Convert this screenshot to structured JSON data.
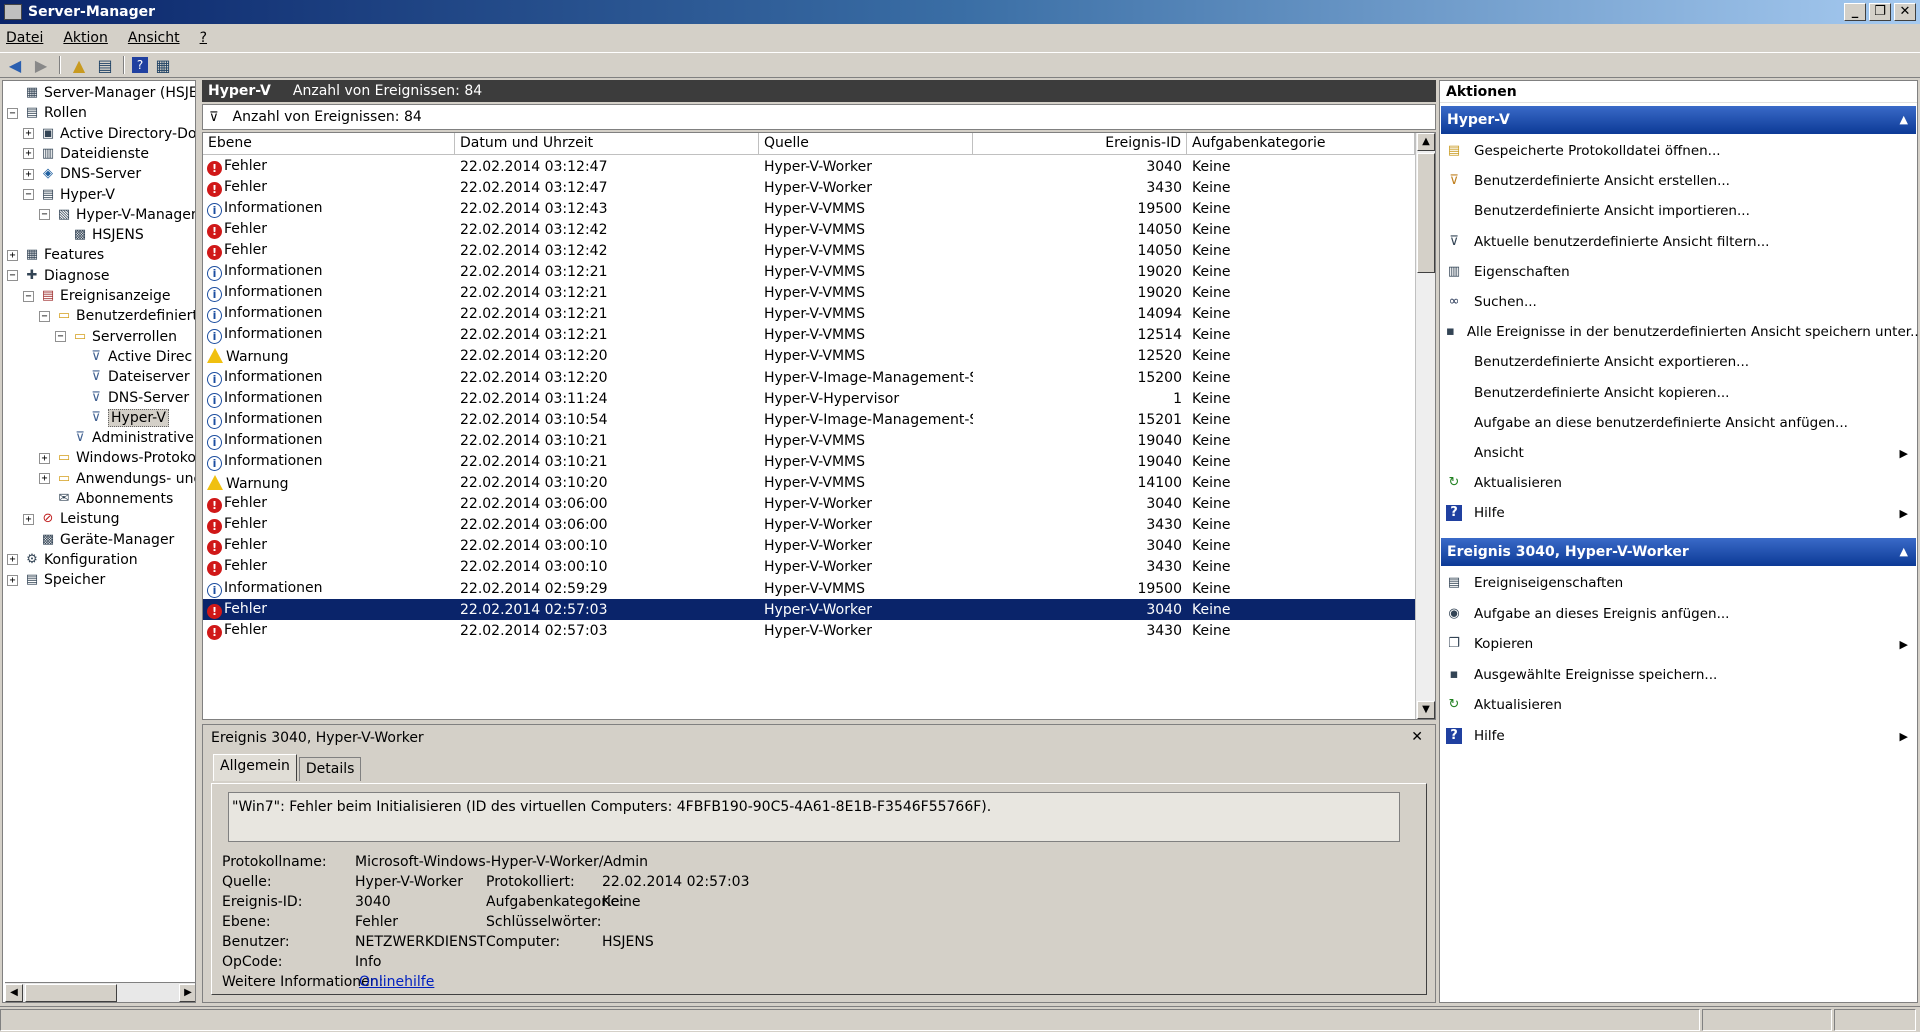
{
  "window": {
    "title": "Server-Manager"
  },
  "menu": [
    "Datei",
    "Aktion",
    "Ansicht",
    "?"
  ],
  "tree": [
    {
      "label": "Server-Manager (HSJENS)",
      "level": 0,
      "exp": "",
      "icon": "server-icon"
    },
    {
      "label": "Rollen",
      "level": 0,
      "exp": "−",
      "icon": "roles-icon"
    },
    {
      "label": "Active Directory-Dom",
      "level": 1,
      "exp": "+",
      "icon": "ad-icon"
    },
    {
      "label": "Dateidienste",
      "level": 1,
      "exp": "+",
      "icon": "files-icon"
    },
    {
      "label": "DNS-Server",
      "level": 1,
      "exp": "+",
      "icon": "dns-icon"
    },
    {
      "label": "Hyper-V",
      "level": 1,
      "exp": "−",
      "icon": "hyperv-icon"
    },
    {
      "label": "Hyper-V-Manager",
      "level": 2,
      "exp": "−",
      "icon": "hyperv-manager-icon"
    },
    {
      "label": "HSJENS",
      "level": 3,
      "exp": "",
      "icon": "host-icon"
    },
    {
      "label": "Features",
      "level": 0,
      "exp": "+",
      "icon": "features-icon"
    },
    {
      "label": "Diagnose",
      "level": 0,
      "exp": "−",
      "icon": "diagnose-icon"
    },
    {
      "label": "Ereignisanzeige",
      "level": 1,
      "exp": "−",
      "icon": "eventviewer-icon"
    },
    {
      "label": "Benutzerdefinierte",
      "level": 2,
      "exp": "−",
      "icon": "folder-icon"
    },
    {
      "label": "Serverrollen",
      "level": 3,
      "exp": "−",
      "icon": "folder-icon"
    },
    {
      "label": "Active Direc",
      "level": 4,
      "exp": "",
      "icon": "filter-icon"
    },
    {
      "label": "Dateiserver",
      "level": 4,
      "exp": "",
      "icon": "filter-icon"
    },
    {
      "label": "DNS-Server",
      "level": 4,
      "exp": "",
      "icon": "filter-icon"
    },
    {
      "label": "Hyper-V",
      "level": 4,
      "exp": "",
      "icon": "filter-icon",
      "selected": true
    },
    {
      "label": "Administrative E",
      "level": 3,
      "exp": "",
      "icon": "filter-icon"
    },
    {
      "label": "Windows-Protokol",
      "level": 2,
      "exp": "+",
      "icon": "folder-icon"
    },
    {
      "label": "Anwendungs- und",
      "level": 2,
      "exp": "+",
      "icon": "folder-icon"
    },
    {
      "label": "Abonnements",
      "level": 2,
      "exp": "",
      "icon": "subscription-icon"
    },
    {
      "label": "Leistung",
      "level": 1,
      "exp": "+",
      "icon": "performance-icon"
    },
    {
      "label": "Geräte-Manager",
      "level": 1,
      "exp": "",
      "icon": "device-icon"
    },
    {
      "label": "Konfiguration",
      "level": 0,
      "exp": "+",
      "icon": "config-icon"
    },
    {
      "label": "Speicher",
      "level": 0,
      "exp": "+",
      "icon": "storage-icon"
    }
  ],
  "center": {
    "header_title": "Hyper-V",
    "header_count": "Anzahl von Ereignissen: 84",
    "filter_text": "Anzahl von Ereignissen: 84",
    "columns": [
      "Ebene",
      "Datum und Uhrzeit",
      "Quelle",
      "Ereignis-ID",
      "Aufgabenkategorie"
    ],
    "rows": [
      {
        "level": "Fehler",
        "type": "error",
        "date": "22.02.2014 03:12:47",
        "source": "Hyper-V-Worker",
        "id": "3040",
        "cat": "Keine"
      },
      {
        "level": "Fehler",
        "type": "error",
        "date": "22.02.2014 03:12:47",
        "source": "Hyper-V-Worker",
        "id": "3430",
        "cat": "Keine"
      },
      {
        "level": "Informationen",
        "type": "info",
        "date": "22.02.2014 03:12:43",
        "source": "Hyper-V-VMMS",
        "id": "19500",
        "cat": "Keine"
      },
      {
        "level": "Fehler",
        "type": "error",
        "date": "22.02.2014 03:12:42",
        "source": "Hyper-V-VMMS",
        "id": "14050",
        "cat": "Keine"
      },
      {
        "level": "Fehler",
        "type": "error",
        "date": "22.02.2014 03:12:42",
        "source": "Hyper-V-VMMS",
        "id": "14050",
        "cat": "Keine"
      },
      {
        "level": "Informationen",
        "type": "info",
        "date": "22.02.2014 03:12:21",
        "source": "Hyper-V-VMMS",
        "id": "19020",
        "cat": "Keine"
      },
      {
        "level": "Informationen",
        "type": "info",
        "date": "22.02.2014 03:12:21",
        "source": "Hyper-V-VMMS",
        "id": "19020",
        "cat": "Keine"
      },
      {
        "level": "Informationen",
        "type": "info",
        "date": "22.02.2014 03:12:21",
        "source": "Hyper-V-VMMS",
        "id": "14094",
        "cat": "Keine"
      },
      {
        "level": "Informationen",
        "type": "info",
        "date": "22.02.2014 03:12:21",
        "source": "Hyper-V-VMMS",
        "id": "12514",
        "cat": "Keine"
      },
      {
        "level": "Warnung",
        "type": "warn",
        "date": "22.02.2014 03:12:20",
        "source": "Hyper-V-VMMS",
        "id": "12520",
        "cat": "Keine"
      },
      {
        "level": "Informationen",
        "type": "info",
        "date": "22.02.2014 03:12:20",
        "source": "Hyper-V-Image-Management-S...",
        "id": "15200",
        "cat": "Keine"
      },
      {
        "level": "Informationen",
        "type": "info",
        "date": "22.02.2014 03:11:24",
        "source": "Hyper-V-Hypervisor",
        "id": "1",
        "cat": "Keine"
      },
      {
        "level": "Informationen",
        "type": "info",
        "date": "22.02.2014 03:10:54",
        "source": "Hyper-V-Image-Management-S...",
        "id": "15201",
        "cat": "Keine"
      },
      {
        "level": "Informationen",
        "type": "info",
        "date": "22.02.2014 03:10:21",
        "source": "Hyper-V-VMMS",
        "id": "19040",
        "cat": "Keine"
      },
      {
        "level": "Informationen",
        "type": "info",
        "date": "22.02.2014 03:10:21",
        "source": "Hyper-V-VMMS",
        "id": "19040",
        "cat": "Keine"
      },
      {
        "level": "Warnung",
        "type": "warn",
        "date": "22.02.2014 03:10:20",
        "source": "Hyper-V-VMMS",
        "id": "14100",
        "cat": "Keine"
      },
      {
        "level": "Fehler",
        "type": "error",
        "date": "22.02.2014 03:06:00",
        "source": "Hyper-V-Worker",
        "id": "3040",
        "cat": "Keine"
      },
      {
        "level": "Fehler",
        "type": "error",
        "date": "22.02.2014 03:06:00",
        "source": "Hyper-V-Worker",
        "id": "3430",
        "cat": "Keine"
      },
      {
        "level": "Fehler",
        "type": "error",
        "date": "22.02.2014 03:00:10",
        "source": "Hyper-V-Worker",
        "id": "3040",
        "cat": "Keine"
      },
      {
        "level": "Fehler",
        "type": "error",
        "date": "22.02.2014 03:00:10",
        "source": "Hyper-V-Worker",
        "id": "3430",
        "cat": "Keine"
      },
      {
        "level": "Informationen",
        "type": "info",
        "date": "22.02.2014 02:59:29",
        "source": "Hyper-V-VMMS",
        "id": "19500",
        "cat": "Keine"
      },
      {
        "level": "Fehler",
        "type": "error",
        "date": "22.02.2014 02:57:03",
        "source": "Hyper-V-Worker",
        "id": "3040",
        "cat": "Keine",
        "selected": true
      },
      {
        "level": "Fehler",
        "type": "error",
        "date": "22.02.2014 02:57:03",
        "source": "Hyper-V-Worker",
        "id": "3430",
        "cat": "Keine"
      }
    ]
  },
  "detail": {
    "title": "Ereignis 3040, Hyper-V-Worker",
    "tabs": [
      "Allgemein",
      "Details"
    ],
    "message": "\"Win7\": Fehler beim Initialisieren (ID des virtuellen Computers: 4FBFB190-90C5-4A61-8E1B-F3546F55766F).",
    "fields": {
      "protokollname_label": "Protokollname:",
      "protokollname": "Microsoft-Windows-Hyper-V-Worker/Admin",
      "quelle_label": "Quelle:",
      "quelle": "Hyper-V-Worker",
      "protokolliert_label": "Protokolliert:",
      "protokolliert": "22.02.2014 02:57:03",
      "ereignisid_label": "Ereignis-ID:",
      "ereignisid": "3040",
      "aufgabe_label": "Aufgabenkategorie:",
      "aufgabe": "Keine",
      "ebene_label": "Ebene:",
      "ebene": "Fehler",
      "schluessel_label": "Schlüsselwörter:",
      "benutzer_label": "Benutzer:",
      "benutzer": "NETZWERKDIENST",
      "computer_label": "Computer:",
      "computer": "HSJENS",
      "opcode_label": "OpCode:",
      "opcode": "Info",
      "weitere_label": "Weitere Informationen:",
      "weitere_link": "Onlinehilfe"
    }
  },
  "actions": {
    "title": "Aktionen",
    "section1": "Hyper-V",
    "items1": [
      {
        "label": "Gespeicherte Protokolldatei öffnen...",
        "icon": "open-log-icon"
      },
      {
        "label": "Benutzerdefinierte Ansicht erstellen...",
        "icon": "filter-create-icon"
      },
      {
        "label": "Benutzerdefinierte Ansicht importieren...",
        "icon": ""
      },
      {
        "label": "Aktuelle benutzerdefinierte Ansicht filtern...",
        "icon": "filter-icon"
      },
      {
        "label": "Eigenschaften",
        "icon": "properties-icon"
      },
      {
        "label": "Suchen...",
        "icon": "binoculars-icon"
      },
      {
        "label": "Alle Ereignisse in der benutzerdefinierten Ansicht speichern unter...",
        "icon": "save-icon"
      },
      {
        "label": "Benutzerdefinierte Ansicht exportieren...",
        "icon": ""
      },
      {
        "label": "Benutzerdefinierte Ansicht kopieren...",
        "icon": ""
      },
      {
        "label": "Aufgabe an diese benutzerdefinierte Ansicht anfügen...",
        "icon": ""
      },
      {
        "label": "Ansicht",
        "icon": "",
        "submenu": true
      },
      {
        "label": "Aktualisieren",
        "icon": "refresh-icon"
      },
      {
        "label": "Hilfe",
        "icon": "help-icon",
        "submenu": true
      }
    ],
    "section2": "Ereignis 3040, Hyper-V-Worker",
    "items2": [
      {
        "label": "Ereigniseigenschaften",
        "icon": "event-properties-icon"
      },
      {
        "label": "Aufgabe an dieses Ereignis anfügen...",
        "icon": "task-icon"
      },
      {
        "label": "Kopieren",
        "icon": "copy-icon",
        "submenu": true
      },
      {
        "label": "Ausgewählte Ereignisse speichern...",
        "icon": "save-icon"
      },
      {
        "label": "Aktualisieren",
        "icon": "refresh-icon"
      },
      {
        "label": "Hilfe",
        "icon": "help-icon",
        "submenu": true
      }
    ]
  }
}
